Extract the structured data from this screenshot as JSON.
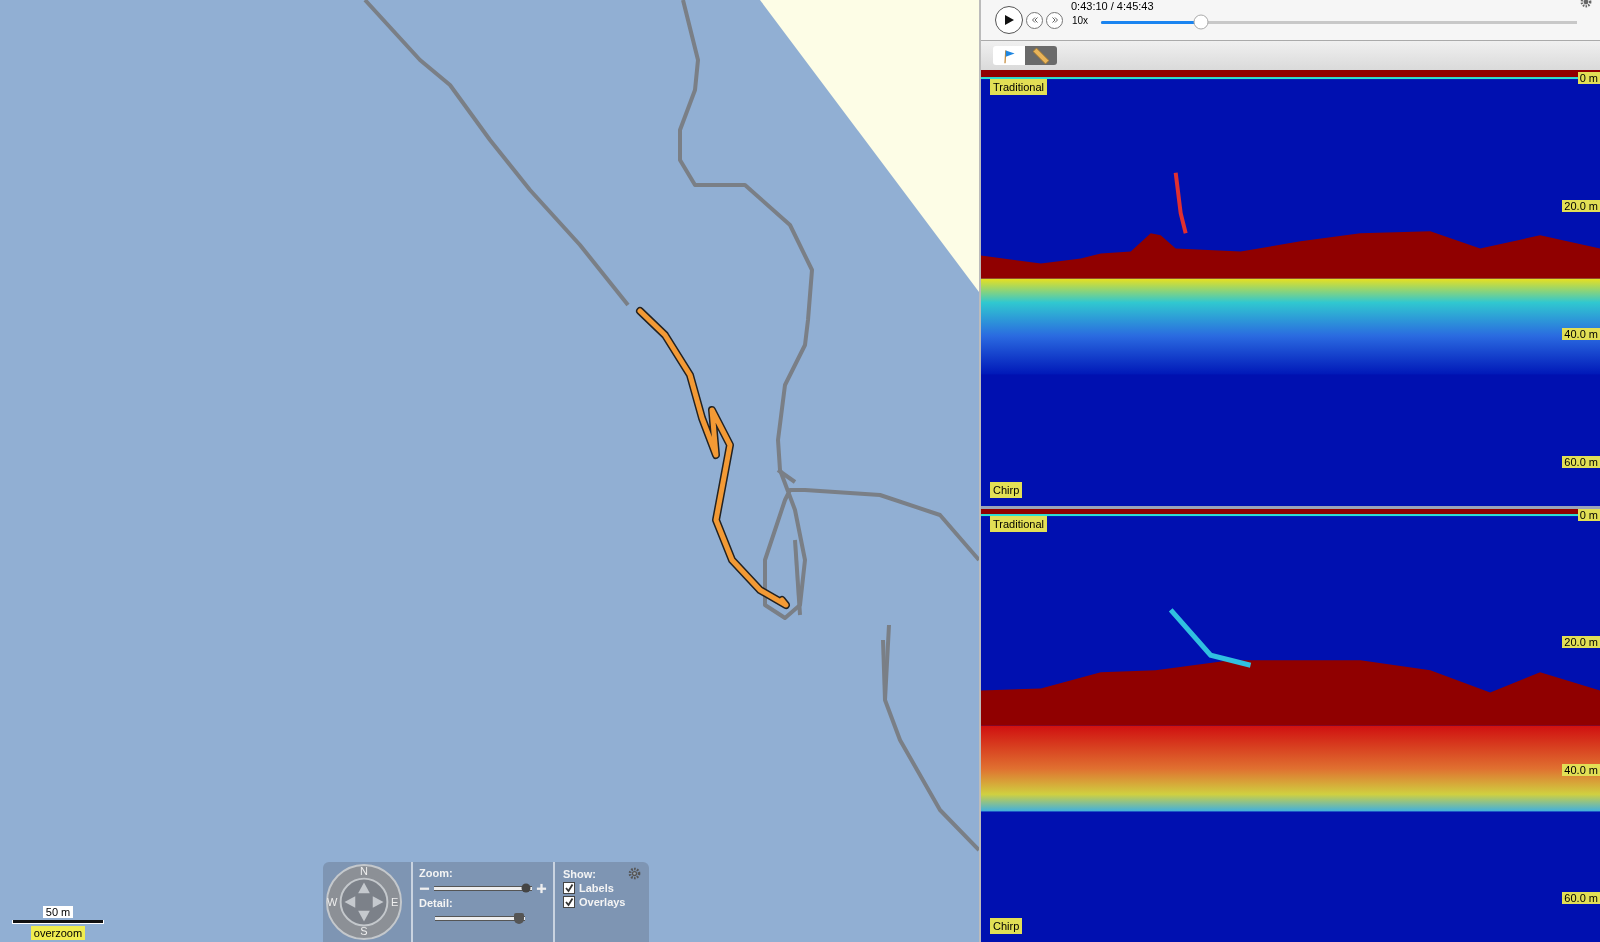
{
  "player": {
    "time": "0:43:10 / 4:45:43",
    "speed": "10x",
    "level": 0.21
  },
  "toolbar": [
    {
      "kind": "flag",
      "selected": false
    },
    {
      "kind": "ruler",
      "selected": true
    }
  ],
  "sonar_views": [
    {
      "top_label": "Traditional",
      "bottom_label": "Chirp",
      "depth_marks": [
        "0 m",
        "20.0 m",
        "40.0 m",
        "60.0 m"
      ]
    },
    {
      "top_label": "Traditional",
      "bottom_label": "Chirp",
      "depth_marks": [
        "0 m",
        "20.0 m",
        "40.0 m",
        "60.0 m"
      ]
    }
  ],
  "map_controls": {
    "compass": [
      "N",
      "E",
      "S",
      "W"
    ],
    "zoom_label": "Zoom:",
    "zoom": {
      "level": 1.0
    },
    "detail_label": "Detail:",
    "detail": {
      "level": 1.0
    },
    "show_label": "Show:",
    "options": [
      {
        "label": "Labels",
        "checked": true
      },
      {
        "label": "Overlays",
        "checked": true
      }
    ]
  },
  "scale": {
    "distance": "50 m",
    "badge": "overzoom"
  }
}
